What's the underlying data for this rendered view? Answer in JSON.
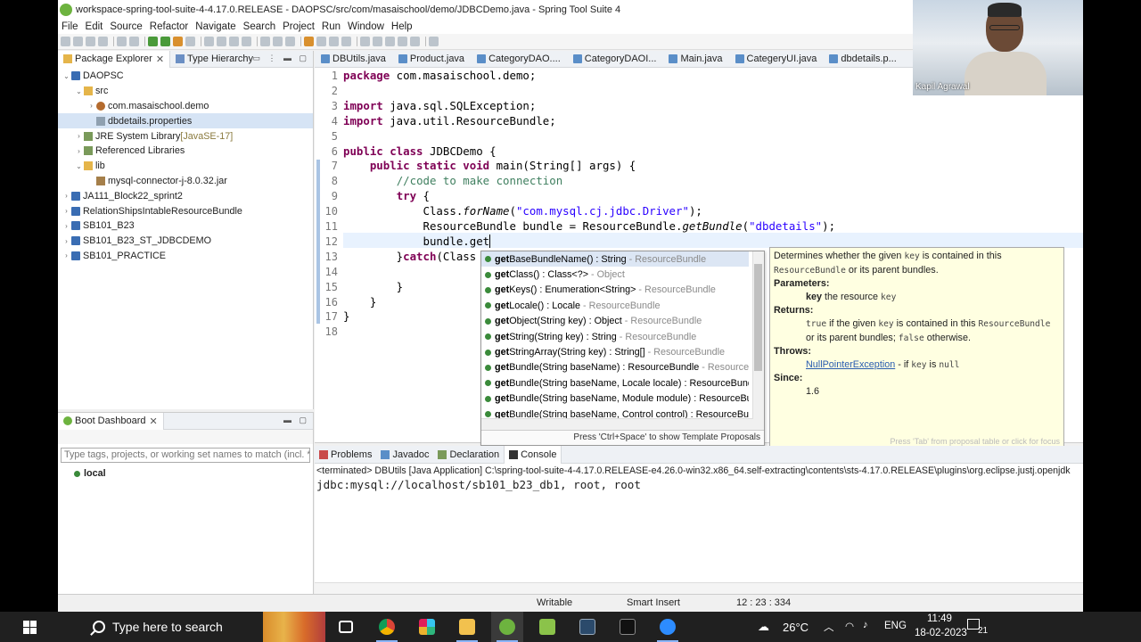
{
  "window": {
    "title": "workspace-spring-tool-suite-4-4.17.0.RELEASE - DAOPSC/src/com/masaischool/demo/JDBCDemo.java - Spring Tool Suite 4"
  },
  "menu": [
    "File",
    "Edit",
    "Source",
    "Refactor",
    "Navigate",
    "Search",
    "Project",
    "Run",
    "Window",
    "Help"
  ],
  "package_explorer": {
    "tabs": [
      "Package Explorer",
      "Type Hierarchy"
    ],
    "items": [
      {
        "label": "DAOPSC",
        "indent": 0,
        "arrow": "⌄",
        "icon": "pj"
      },
      {
        "label": "src",
        "indent": 1,
        "arrow": "⌄",
        "icon": "fo"
      },
      {
        "label": "com.masaischool.demo",
        "indent": 2,
        "arrow": "›",
        "icon": "pk"
      },
      {
        "label": "dbdetails.properties",
        "indent": 2,
        "arrow": "",
        "icon": "fi",
        "selected": true
      },
      {
        "label": "JRE System Library",
        "decor": "[JavaSE-17]",
        "indent": 1,
        "arrow": "›",
        "icon": "lb"
      },
      {
        "label": "Referenced Libraries",
        "indent": 1,
        "arrow": "›",
        "icon": "lb"
      },
      {
        "label": "lib",
        "indent": 1,
        "arrow": "⌄",
        "icon": "fo"
      },
      {
        "label": "mysql-connector-j-8.0.32.jar",
        "indent": 2,
        "arrow": "",
        "icon": "ja"
      },
      {
        "label": "JA111_Block22_sprint2",
        "indent": 0,
        "arrow": "›",
        "icon": "pj"
      },
      {
        "label": "RelationShipsIntableResourceBundle",
        "indent": 0,
        "arrow": "›",
        "icon": "pj"
      },
      {
        "label": "SB101_B23",
        "indent": 0,
        "arrow": "›",
        "icon": "pj"
      },
      {
        "label": "SB101_B23_ST_JDBCDEMO",
        "indent": 0,
        "arrow": "›",
        "icon": "pj"
      },
      {
        "label": "SB101_PRACTICE",
        "indent": 0,
        "arrow": "›",
        "icon": "pj"
      }
    ]
  },
  "boot_dashboard": {
    "title": "Boot Dashboard",
    "placeholder": "Type tags, projects, or working set names to match (incl. * and ? wildcards)",
    "item": "local"
  },
  "editor": {
    "tabs": [
      "DBUtils.java",
      "Product.java",
      "CategoryDAO....",
      "CategoryDAOI...",
      "Main.java",
      "CategeryUI.java",
      "dbdetails.p..."
    ],
    "line_numbers": [
      "1",
      "2",
      "3",
      "4",
      "5",
      "6",
      "7",
      "8",
      "9",
      "10",
      "11",
      "12",
      "13",
      "14",
      "15",
      "16",
      "17",
      "18"
    ],
    "lines": [
      "<span class=\"kw\">package</span> com.masaischool.demo;",
      "",
      "<span class=\"kw\">import</span> java.sql.SQLException;",
      "<span class=\"kw\">import</span> java.util.ResourceBundle;",
      "",
      "<span class=\"kw\">public class</span> JDBCDemo {",
      "    <span class=\"kw\">public static void</span> main(String[] args) {",
      "        <span class=\"cm\">//code to make connection</span>",
      "        <span class=\"kw\">try</span> {",
      "            Class.<span class=\"it\">forName</span>(<span class=\"st\">\"com.mysql.cj.jdbc.Driver\"</span>);",
      "            ResourceBundle bundle = ResourceBundle.<span class=\"it\">getBundle</span>(<span class=\"st\">\"dbdetails\"</span>);",
      "            bundle.get|",
      "        }<span class=\"kw\">catch</span>(Class",
      "",
      "        }",
      "    }",
      "}",
      ""
    ]
  },
  "content_assist": {
    "proposals": [
      {
        "name": "getBaseBundleName() : String",
        "decl": "ResourceBundle",
        "sep": " - "
      },
      {
        "name": "getClass() : Class<?>",
        "decl": "Object",
        "sep": " - "
      },
      {
        "name": "getKeys() : Enumeration<String>",
        "decl": "ResourceBundle",
        "sep": " - "
      },
      {
        "name": "getLocale() : Locale",
        "decl": "ResourceBundle",
        "sep": " - "
      },
      {
        "name": "getObject(String key) : Object",
        "decl": "ResourceBundle",
        "sep": " - "
      },
      {
        "name": "getString(String key) : String",
        "decl": "ResourceBundle",
        "sep": " - "
      },
      {
        "name": "getStringArray(String key) : String[]",
        "decl": "ResourceBundle",
        "sep": " - "
      },
      {
        "name": "getBundle(String baseName) : ResourceBundle",
        "decl": "ResourceBun",
        "sep": " - "
      },
      {
        "name": "getBundle(String baseName, Locale locale) : ResourceBundle",
        "decl": "",
        "sep": " -"
      },
      {
        "name": "getBundle(String baseName, Module module) : ResourceBundle",
        "decl": "",
        "sep": " -"
      },
      {
        "name": "getBundle(String baseName, Control control) : ResourceBundl",
        "decl": "",
        "sep": ""
      }
    ],
    "footer": "Press 'Ctrl+Space' to show Template Proposals"
  },
  "javadoc": {
    "d1": "Determines whether the given ",
    "d2": "key",
    "d3": " is contained in this",
    "d4": "ResourceBundle",
    "d5": " or its parent bundles.",
    "params_h": "Parameters:",
    "p1": "key",
    "p2": " the resource ",
    "p3": "key",
    "returns_h": "Returns:",
    "r1": "true",
    "r2": " if the given ",
    "r3": "key",
    "r4": " is contained in this ",
    "r5": "ResourceBundle",
    "r6": "or its parent bundles; ",
    "r7": "false",
    "r8": " otherwise.",
    "throws_h": "Throws:",
    "t1": "NullPointerException",
    "t2": " - if ",
    "t3": "key",
    "t4": " is ",
    "t5": "null",
    "since_h": "Since:",
    "since": "1.6",
    "hint": "Press 'Tab' from proposal table or click for focus"
  },
  "console": {
    "tabs": [
      "Problems",
      "Javadoc",
      "Declaration",
      "Console"
    ],
    "terminated": "<terminated> DBUtils [Java Application] C:\\spring-tool-suite-4-4.17.0.RELEASE-e4.26.0-win32.x86_64.self-extracting\\contents\\sts-4.17.0.RELEASE\\plugins\\org.eclipse.justj.openjdk",
    "output": "jdbc:mysql://localhost/sb101_b23_db1, root, root"
  },
  "status": {
    "writable": "Writable",
    "insert": "Smart Insert",
    "position": "12 : 23 : 334"
  },
  "webcam": {
    "name": "Kapil Agrawal"
  },
  "taskbar": {
    "search": "Type here to search",
    "temp": "26°C",
    "lang": "ENG",
    "time": "11:49",
    "date": "18-02-2023",
    "notif": "21"
  }
}
